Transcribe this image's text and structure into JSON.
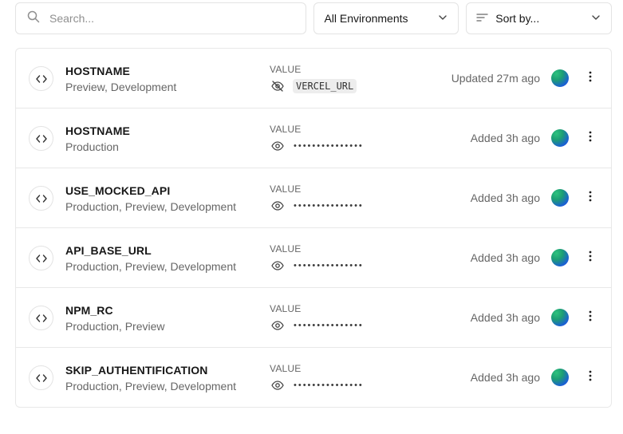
{
  "search": {
    "placeholder": "Search...",
    "value": ""
  },
  "environment_filter": {
    "selected": "All Environments"
  },
  "sort": {
    "label": "Sort by..."
  },
  "env_vars": [
    {
      "name": "HOSTNAME",
      "environments": "Preview, Development",
      "value_label": "VALUE",
      "value_hidden": false,
      "value": "VERCEL_URL",
      "status": "Updated 27m ago"
    },
    {
      "name": "HOSTNAME",
      "environments": "Production",
      "value_label": "VALUE",
      "value_hidden": true,
      "value": "•••••••••••••••",
      "status": "Added 3h ago"
    },
    {
      "name": "USE_MOCKED_API",
      "environments": "Production, Preview, Development",
      "value_label": "VALUE",
      "value_hidden": true,
      "value": "•••••••••••••••",
      "status": "Added 3h ago"
    },
    {
      "name": "API_BASE_URL",
      "environments": "Production, Preview, Development",
      "value_label": "VALUE",
      "value_hidden": true,
      "value": "•••••••••••••••",
      "status": "Added 3h ago"
    },
    {
      "name": "NPM_RC",
      "environments": "Production, Preview",
      "value_label": "VALUE",
      "value_hidden": true,
      "value": "•••••••••••••••",
      "status": "Added 3h ago"
    },
    {
      "name": "SKIP_AUTHENTIFICATION",
      "environments": "Production, Preview, Development",
      "value_label": "VALUE",
      "value_hidden": true,
      "value": "•••••••••••••••",
      "status": "Added 3h ago"
    }
  ],
  "colors": {
    "border": "#e8e8e8",
    "muted_text": "#666666",
    "avatar_gradient_start": "#2ec27e",
    "avatar_gradient_end": "#1a3fcf"
  }
}
